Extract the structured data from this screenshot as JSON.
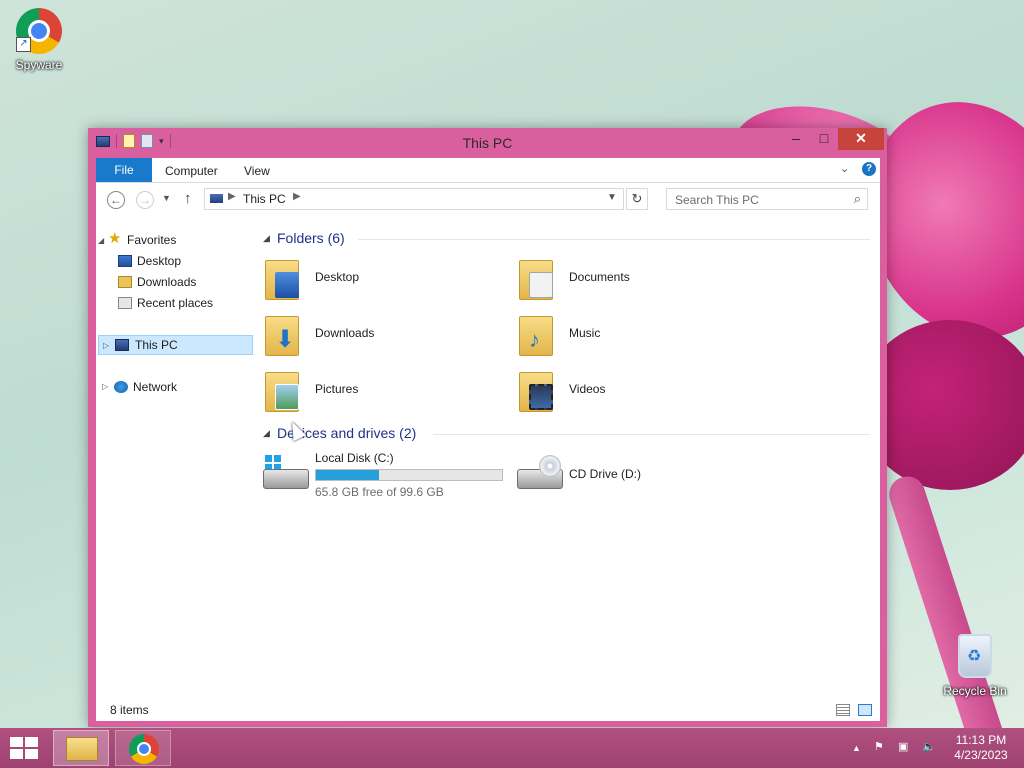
{
  "desktop": {
    "icons": [
      {
        "label": "Spyware",
        "icon": "chrome-icon"
      },
      {
        "label": "Recycle Bin",
        "icon": "recycle-bin-icon"
      }
    ]
  },
  "window": {
    "title": "This PC",
    "controls": {
      "minimize": "–",
      "maximize": "□",
      "close": "✕"
    }
  },
  "ribbon": {
    "tabs": [
      {
        "label": "File",
        "active": true
      },
      {
        "label": "Computer"
      },
      {
        "label": "View"
      }
    ],
    "help": "?"
  },
  "address_bar": {
    "path": "This PC",
    "search_placeholder": "Search This PC"
  },
  "navigation": {
    "favorites": {
      "label": "Favorites",
      "items": [
        {
          "label": "Desktop",
          "icon": "desktop-icon"
        },
        {
          "label": "Downloads",
          "icon": "downloads-icon"
        },
        {
          "label": "Recent places",
          "icon": "recent-places-icon"
        }
      ]
    },
    "this_pc": {
      "label": "This PC",
      "selected": true
    },
    "network": {
      "label": "Network"
    }
  },
  "content": {
    "folders_header": "Folders (6)",
    "folders": [
      {
        "label": "Desktop",
        "icon": "desktop-folder-icon"
      },
      {
        "label": "Documents",
        "icon": "documents-folder-icon"
      },
      {
        "label": "Downloads",
        "icon": "downloads-folder-icon"
      },
      {
        "label": "Music",
        "icon": "music-folder-icon"
      },
      {
        "label": "Pictures",
        "icon": "pictures-folder-icon"
      },
      {
        "label": "Videos",
        "icon": "videos-folder-icon"
      }
    ],
    "drives_header": "Devices and drives (2)",
    "drives": [
      {
        "label": "Local Disk (C:)",
        "free_text": "65.8 GB free of 99.6 GB",
        "used_fraction": 0.339,
        "icon": "hard-disk-icon"
      },
      {
        "label": "CD Drive (D:)",
        "icon": "cd-drive-icon"
      }
    ]
  },
  "status_bar": {
    "items_text": "8 items"
  },
  "taskbar": {
    "clock_time": "11:13 PM",
    "clock_date": "4/23/2023"
  },
  "colors": {
    "window_frame": "#d95f9f",
    "accent": "#1979ca",
    "taskbar": "#a8487a",
    "group_header": "#1e3287"
  }
}
